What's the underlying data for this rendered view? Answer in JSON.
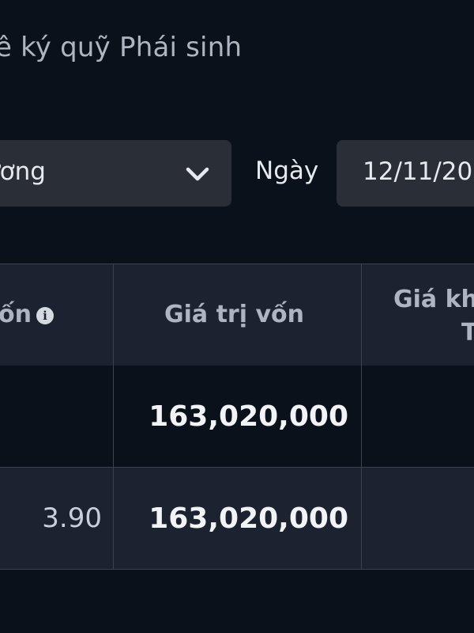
{
  "page": {
    "title": "ê ký quỹ Phái sinh"
  },
  "filters": {
    "select_value": "ương",
    "date_label": "Ngày",
    "date_value": "12/11/20"
  },
  "table": {
    "headers": {
      "col1": "ốn",
      "col2": "Giá trị vốn",
      "col3_line1": "Giá kh",
      "col3_line2": "T"
    },
    "rows": [
      {
        "col1": "",
        "col2": "163,020,000",
        "col3": ""
      },
      {
        "col1": "3.90",
        "col2": "163,020,000",
        "col3": ""
      }
    ]
  },
  "icons": {
    "select_chevron": "chevron-down-icon",
    "header_info": "info-icon"
  },
  "colors": {
    "background": "#0b111b",
    "header_bg": "#1c2230",
    "input_bg": "#2a2e36"
  }
}
